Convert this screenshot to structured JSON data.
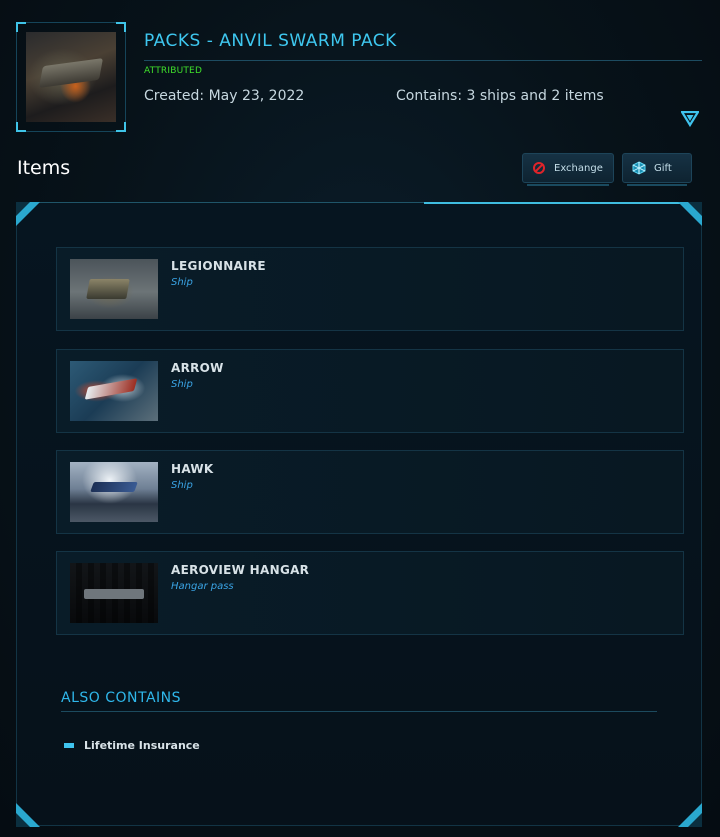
{
  "header": {
    "title": "PACKS - ANVIL SWARM PACK",
    "status": "ATTRIBUTED",
    "created": "Created: May 23, 2022",
    "contains": "Contains: 3 ships and 2 items"
  },
  "items_section": {
    "heading": "Items",
    "exchange_label": "Exchange",
    "gift_label": "Gift",
    "items": [
      {
        "name": "LEGIONNAIRE",
        "type": "Ship"
      },
      {
        "name": "ARROW",
        "type": "Ship"
      },
      {
        "name": "HAWK",
        "type": "Ship"
      },
      {
        "name": "AEROVIEW HANGAR",
        "type": "Hangar pass"
      }
    ]
  },
  "also_contains": {
    "heading": "ALSO CONTAINS",
    "items": [
      "Lifetime Insurance"
    ]
  },
  "colors": {
    "accent": "#3ec7ef",
    "status_green": "#3fe02b",
    "item_type_blue": "#3aa3e4",
    "exchange_icon_red": "#e0242a"
  },
  "icons": {
    "exchange": "prohibited-circle-icon",
    "gift": "gift-cube-icon",
    "expand": "triangle-down-icon"
  }
}
